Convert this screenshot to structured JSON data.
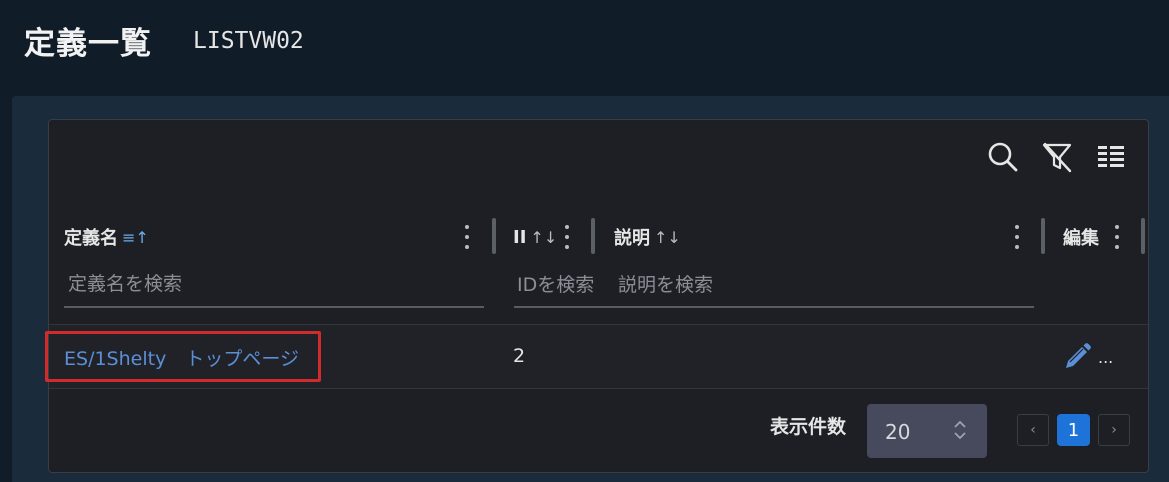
{
  "header": {
    "title": "定義一覧",
    "code": "LISTVW02"
  },
  "toolbar": {
    "search_icon": "search-icon",
    "filter_clear_icon": "filter-off-icon",
    "columns_icon": "columns-icon"
  },
  "table": {
    "columns": [
      {
        "label": "定義名",
        "sort": "≡↑",
        "filter_placeholder": "定義名を検索"
      },
      {
        "label": "II",
        "sort": "↑↓",
        "filter_placeholder": "IDを検索"
      },
      {
        "label": "説明",
        "sort": "↑↓",
        "filter_placeholder": "説明を検索"
      },
      {
        "label": "編集"
      }
    ],
    "rows": [
      {
        "name": "ES/1Shelty　トップページ",
        "id": "2",
        "description": "",
        "edit_more": "..."
      }
    ]
  },
  "pagination": {
    "page_size_label": "表示件数",
    "page_size": "20",
    "prev": "‹",
    "current_page": "1",
    "next": "›"
  },
  "colors": {
    "background": "#101c28",
    "panel": "#1a2b3b",
    "card": "#1e1f24",
    "link": "#5b8fd6",
    "accent": "#1e73d8",
    "highlight": "#d22b2b"
  }
}
